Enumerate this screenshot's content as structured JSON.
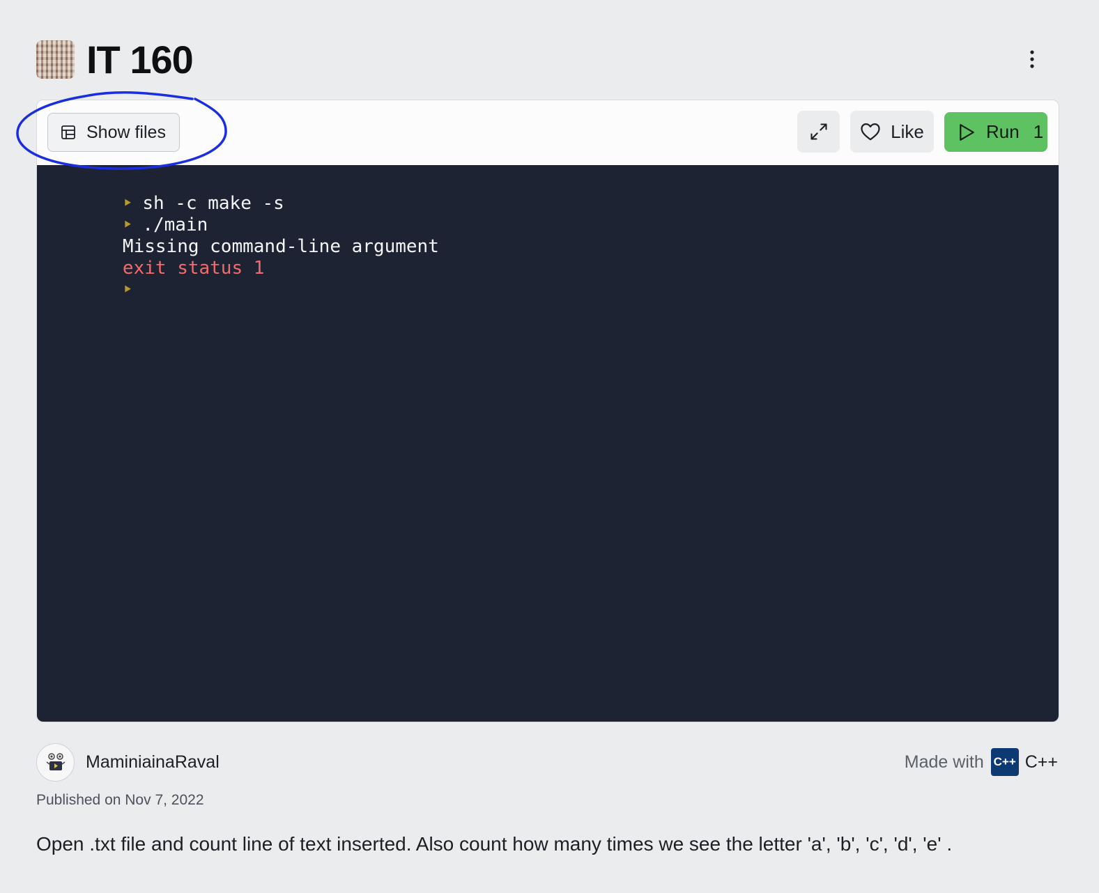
{
  "header": {
    "title": "IT 160",
    "menu_icon": "kebab-vertical-icon"
  },
  "toolbar": {
    "show_files_label": "Show files",
    "show_files_icon": "file-tree-icon",
    "expand_icon": "expand-arrows-icon",
    "like_label": "Like",
    "like_icon": "heart-icon",
    "run_label": "Run",
    "run_icon": "play-icon",
    "run_count": "1"
  },
  "console": {
    "lines": [
      {
        "prompt": true,
        "text": "sh -c make -s",
        "type": "command"
      },
      {
        "prompt": true,
        "text": "./main",
        "type": "command"
      },
      {
        "prompt": false,
        "text": "Missing command-line argument",
        "type": "output"
      },
      {
        "prompt": false,
        "text": "exit status 1",
        "type": "error"
      },
      {
        "prompt": true,
        "text": "",
        "type": "command"
      }
    ]
  },
  "footer": {
    "author": "MaminiainaRaval",
    "made_with_label": "Made with",
    "language": "C++",
    "language_logo_text": "C++",
    "published": "Published on Nov 7, 2022",
    "description": "Open .txt file and count line of text inserted. Also count how many times we see the letter 'a', 'b', 'c', 'd', 'e' ."
  },
  "colors": {
    "background": "#ebecee",
    "console_bg": "#1d2333",
    "run_green": "#5ec262",
    "error_red": "#f36b6b",
    "prompt_gold": "#b79a2a",
    "annotation_blue": "#1a2ee0"
  }
}
